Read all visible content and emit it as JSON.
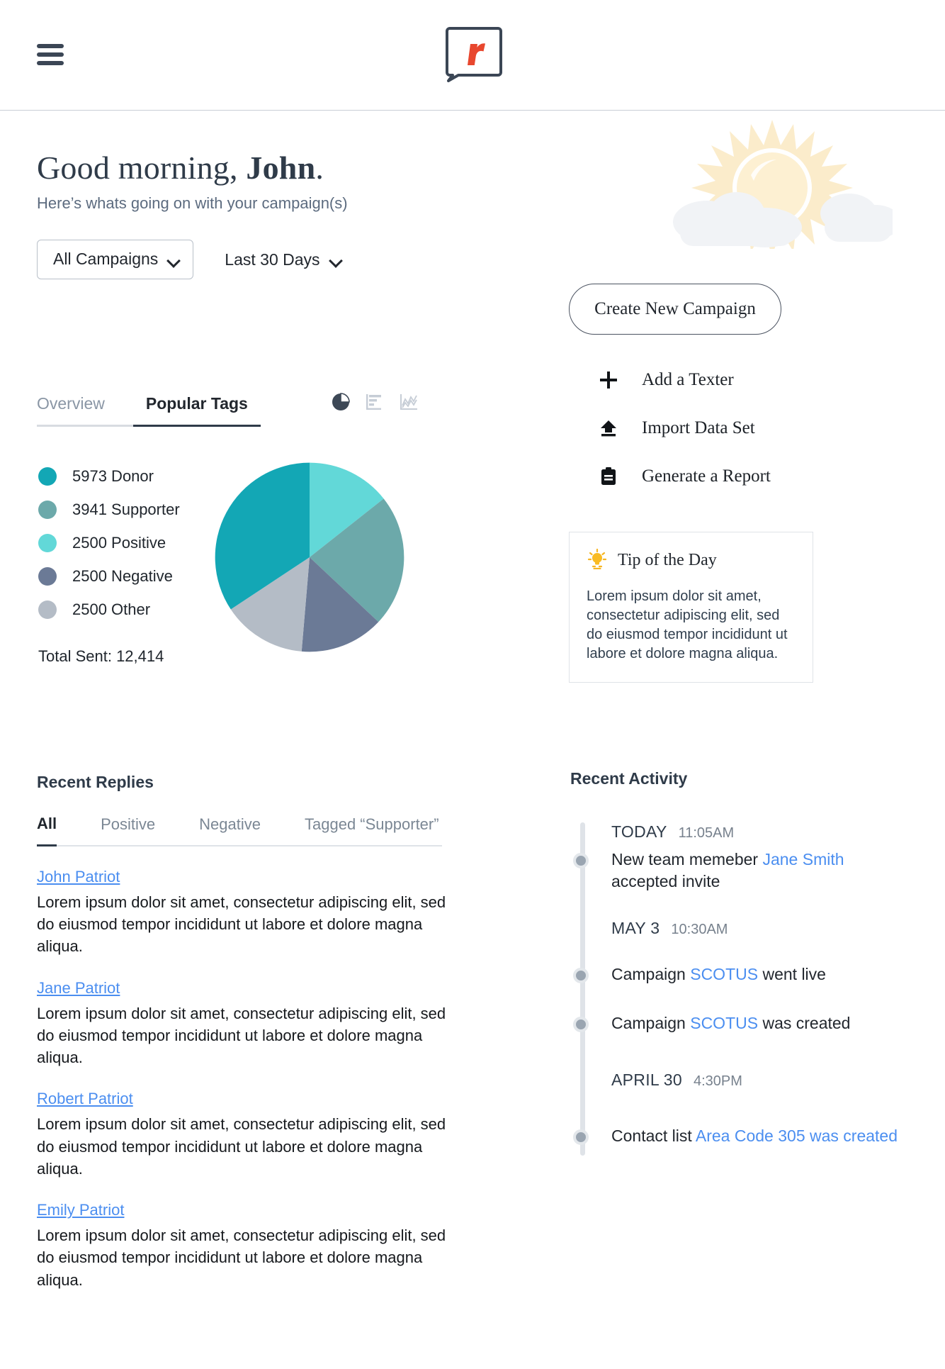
{
  "topbar": {
    "menu_icon": "hamburger-menu-icon",
    "logo_letter": "r",
    "logo_icon": "speech-bubble-logo"
  },
  "hero": {
    "greeting_prefix": "Good morning, ",
    "greeting_name": "John",
    "greeting_suffix": ".",
    "subtitle": "Here’s whats going on with your campaign(s)",
    "weather_icon": "sun-with-clouds-icon"
  },
  "filters": {
    "campaign_select": "All Campaigns",
    "date_select": "Last 30 Days",
    "chevron_icon": "chevron-down-icon"
  },
  "chart_panel": {
    "tabs": [
      {
        "label": "Overview",
        "active": false
      },
      {
        "label": "Popular Tags",
        "active": true
      }
    ],
    "view_icons": [
      {
        "name": "pie-chart-icon",
        "active": true
      },
      {
        "name": "bar-chart-icon",
        "active": false
      },
      {
        "name": "line-chart-icon",
        "active": false
      }
    ],
    "total_label": "Total Sent: 12,414"
  },
  "chart_data": {
    "type": "pie",
    "title": "Popular Tags",
    "categories": [
      "Donor",
      "Supporter",
      "Positive",
      "Negative",
      "Other"
    ],
    "values": [
      5973,
      3941,
      2500,
      2500,
      2500
    ],
    "labels": [
      "5973 Donor",
      "3941 Supporter",
      "2500 Positive",
      "2500 Negative",
      "2500 Other"
    ],
    "colors": [
      "#13a7b5",
      "#6ca9aa",
      "#62d8d8",
      "#6b7a96",
      "#b4bcc6"
    ],
    "total": 12414,
    "total_text": "Total Sent: 12,414",
    "legend_position": "left",
    "grid": false
  },
  "right_panel": {
    "cta_label": "Create New Campaign",
    "actions": [
      {
        "icon": "plus-icon",
        "label": "Add a Texter"
      },
      {
        "icon": "upload-icon",
        "label": "Import Data Set"
      },
      {
        "icon": "clipboard-icon",
        "label": "Generate a Report"
      }
    ],
    "tip": {
      "icon": "lightbulb-icon",
      "title": "Tip of the Day",
      "body": "Lorem ipsum dolor sit amet, consectetur adipiscing elit, sed do eiusmod tempor incididunt ut labore et dolore magna aliqua."
    }
  },
  "recent_replies": {
    "title": "Recent Replies",
    "tabs": [
      {
        "label": "All",
        "active": true
      },
      {
        "label": "Positive",
        "active": false
      },
      {
        "label": "Negative",
        "active": false
      },
      {
        "label": "Tagged “Supporter”",
        "active": false
      }
    ],
    "items": [
      {
        "author": "John Patriot",
        "text": "Lorem ipsum dolor sit amet, consectetur adipiscing elit, sed do eiusmod tempor incididunt ut labore et dolore magna aliqua."
      },
      {
        "author": "Jane Patriot",
        "text": "Lorem ipsum dolor sit amet, consectetur adipiscing elit, sed do eiusmod tempor incididunt ut labore et dolore magna aliqua."
      },
      {
        "author": "Robert Patriot",
        "text": "Lorem ipsum dolor sit amet, consectetur adipiscing elit, sed do eiusmod tempor incididunt ut labore et dolore magna aliqua."
      },
      {
        "author": "Emily Patriot",
        "text": "Lorem ipsum dolor sit amet, consectetur adipiscing elit, sed do eiusmod tempor incididunt ut labore et dolore magna aliqua."
      }
    ]
  },
  "recent_activity": {
    "title": "Recent Activity",
    "groups": [
      {
        "date": "TODAY",
        "time": "11:05AM",
        "entries": [
          {
            "pre": "New team memeber ",
            "link": "Jane Smith",
            "post": " accepted invite"
          }
        ]
      },
      {
        "date": "MAY 3",
        "time": "10:30AM",
        "entries": [
          {
            "pre": "Campaign ",
            "link": "SCOTUS",
            "post": " went live"
          },
          {
            "pre": "Campaign ",
            "link": "SCOTUS",
            "post": " was created"
          }
        ]
      },
      {
        "date": "APRIL 30",
        "time": "4:30PM",
        "entries": [
          {
            "pre": "Contact list ",
            "link": "Area Code 305 was created",
            "post": ""
          }
        ]
      }
    ]
  },
  "colors": {
    "accent_red": "#e8472e",
    "link_blue": "#4b8ef0",
    "text_dark": "#2f3b49",
    "sun_yellow": "#fbecc2"
  }
}
